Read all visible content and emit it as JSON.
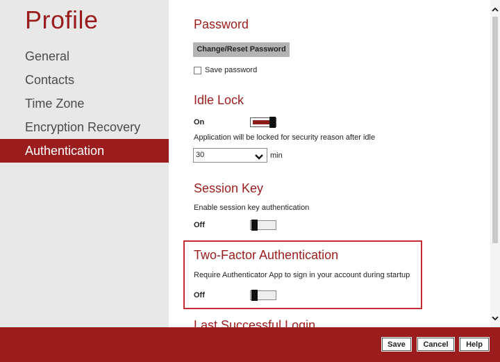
{
  "sidebar": {
    "title": "Profile",
    "items": [
      {
        "label": "General"
      },
      {
        "label": "Contacts"
      },
      {
        "label": "Time Zone"
      },
      {
        "label": "Encryption Recovery"
      },
      {
        "label": "Authentication",
        "active": true
      }
    ]
  },
  "password": {
    "title": "Password",
    "change_button": "Change/Reset Password",
    "save_label": "Save password",
    "save_checked": false
  },
  "idle_lock": {
    "title": "Idle Lock",
    "state": "On",
    "enabled": true,
    "description": "Application will be locked for security reason after idle",
    "value": "30",
    "unit": "min"
  },
  "session_key": {
    "title": "Session Key",
    "description": "Enable session key authentication",
    "state": "Off",
    "enabled": false
  },
  "two_factor": {
    "title": "Two-Factor Authentication",
    "description": "Require Authenticator App to sign in your account during startup",
    "state": "Off",
    "enabled": false
  },
  "last_login": {
    "title": "Last Successful Login"
  },
  "footer": {
    "save": "Save",
    "cancel": "Cancel",
    "help": "Help"
  },
  "colors": {
    "accent": "#9b1c1c",
    "highlight": "#c62a35"
  },
  "icons": [
    "chevron-down-icon",
    "scroll-up-icon",
    "scroll-down-icon"
  ]
}
